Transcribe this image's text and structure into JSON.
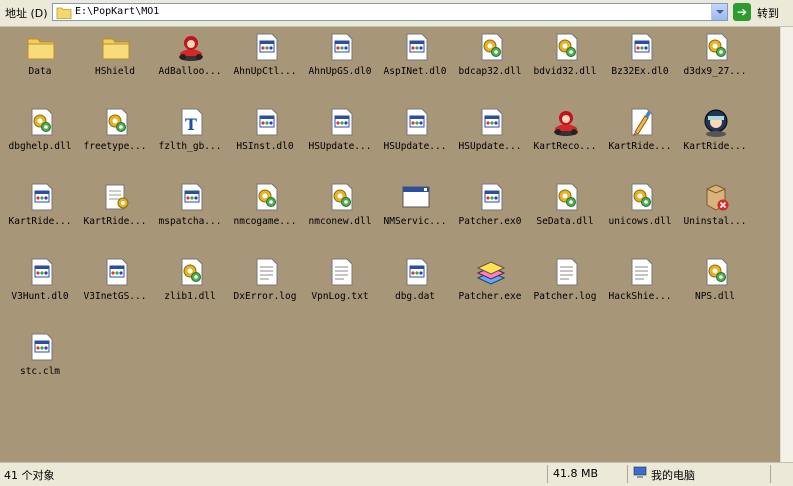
{
  "address_bar": {
    "label": "地址 (D)",
    "path": "E:\\PopKart\\MO1",
    "go_label": "转到"
  },
  "files": [
    {
      "name": "Data",
      "icon": "folder"
    },
    {
      "name": "HShield",
      "icon": "folder"
    },
    {
      "name": "AdBalloo...",
      "icon": "kart"
    },
    {
      "name": "AhnUpCtl...",
      "icon": "dll-window"
    },
    {
      "name": "AhnUpGS.dl0",
      "icon": "dll-window"
    },
    {
      "name": "AspINet.dl0",
      "icon": "dll-window"
    },
    {
      "name": "bdcap32.dll",
      "icon": "dll-gear"
    },
    {
      "name": "bdvid32.dll",
      "icon": "dll-gear"
    },
    {
      "name": "Bz32Ex.dl0",
      "icon": "dll-window"
    },
    {
      "name": "d3dx9_27...",
      "icon": "dll-gear"
    },
    {
      "name": "dbghelp.dll",
      "icon": "dll-gear"
    },
    {
      "name": "freetype...",
      "icon": "dll-gear"
    },
    {
      "name": "fzlth_gb...",
      "icon": "font"
    },
    {
      "name": "HSInst.dl0",
      "icon": "dll-window"
    },
    {
      "name": "HSUpdate...",
      "icon": "dll-window"
    },
    {
      "name": "HSUpdate...",
      "icon": "dll-window"
    },
    {
      "name": "HSUpdate...",
      "icon": "dll-window"
    },
    {
      "name": "KartReco...",
      "icon": "kart"
    },
    {
      "name": "KartRide...",
      "icon": "brush"
    },
    {
      "name": "KartRide...",
      "icon": "racer"
    },
    {
      "name": "KartRide...",
      "icon": "dll-window"
    },
    {
      "name": "KartRide...",
      "icon": "notepad-gear"
    },
    {
      "name": "mspatcha...",
      "icon": "dll-window"
    },
    {
      "name": "nmcogame...",
      "icon": "dll-gear"
    },
    {
      "name": "nmconew.dll",
      "icon": "dll-gear"
    },
    {
      "name": "NMServic...",
      "icon": "app-window"
    },
    {
      "name": "Patcher.ex0",
      "icon": "dll-window"
    },
    {
      "name": "SeData.dll",
      "icon": "dll-gear"
    },
    {
      "name": "unicows.dll",
      "icon": "dll-gear"
    },
    {
      "name": "Uninstal...",
      "icon": "uninstall"
    },
    {
      "name": "V3Hunt.dl0",
      "icon": "dll-window"
    },
    {
      "name": "V3InetGS...",
      "icon": "dll-window"
    },
    {
      "name": "zlib1.dll",
      "icon": "dll-gear"
    },
    {
      "name": "DxError.log",
      "icon": "text"
    },
    {
      "name": "VpnLog.txt",
      "icon": "text"
    },
    {
      "name": "dbg.dat",
      "icon": "dll-window"
    },
    {
      "name": "Patcher.exe",
      "icon": "layers"
    },
    {
      "name": "Patcher.log",
      "icon": "text"
    },
    {
      "name": "HackShie...",
      "icon": "text"
    },
    {
      "name": "NPS.dll",
      "icon": "dll-gear"
    },
    {
      "name": "stc.clm",
      "icon": "dll-window"
    }
  ],
  "status_bar": {
    "count": "41 个对象",
    "size": "41.8 MB",
    "location": "我的电脑"
  }
}
